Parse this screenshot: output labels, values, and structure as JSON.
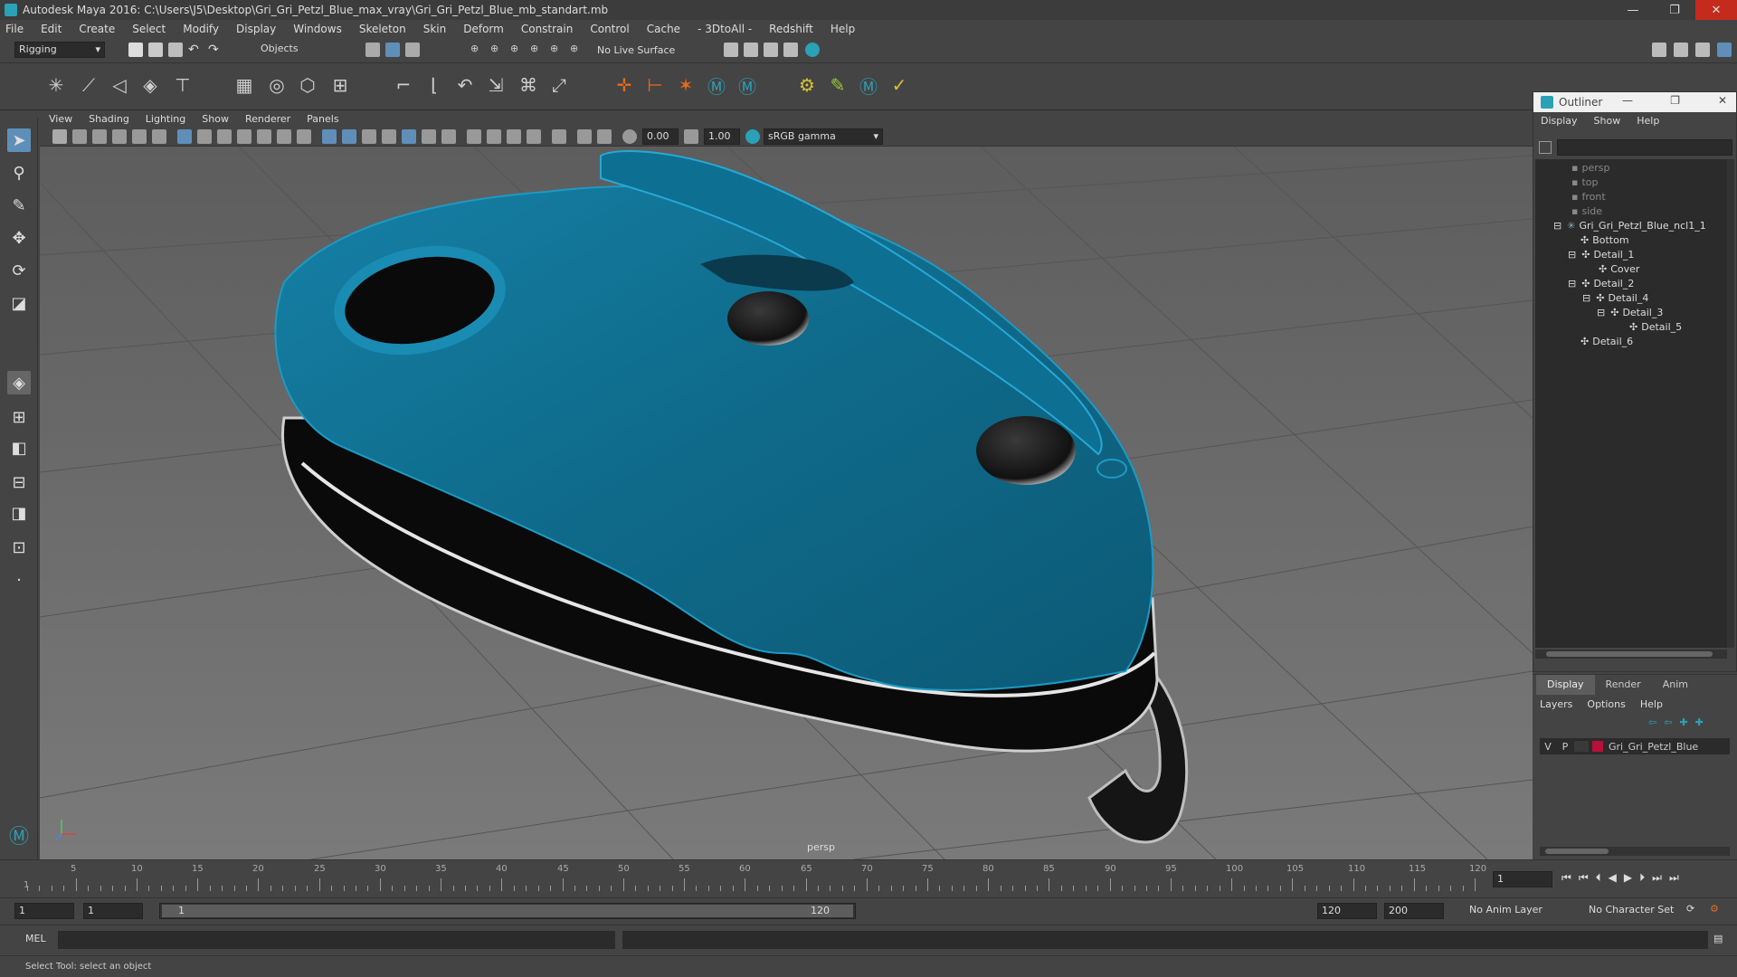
{
  "window": {
    "title": "Autodesk Maya 2016: C:\\Users\\J5\\Desktop\\Gri_Gri_Petzl_Blue_max_vray\\Gri_Gri_Petzl_Blue_mb_standart.mb",
    "min": "—",
    "max": "❐",
    "close": "✕"
  },
  "menubar": [
    "File",
    "Edit",
    "Create",
    "Select",
    "Modify",
    "Display",
    "Windows",
    "Skeleton",
    "Skin",
    "Deform",
    "Constrain",
    "Control",
    "Cache",
    "- 3DtoAll -",
    "Redshift",
    "Help"
  ],
  "statusline": {
    "menuset": "Rigging",
    "select_mode": "Objects",
    "live_surface": "No Live Surface"
  },
  "panel": {
    "menus": [
      "View",
      "Shading",
      "Lighting",
      "Show",
      "Renderer",
      "Panels"
    ],
    "exposure": "0.00",
    "gamma": "1.00",
    "color_space": "sRGB gamma",
    "camera_label": "persp"
  },
  "outliner": {
    "title": "Outliner",
    "menus": [
      "Display",
      "Show",
      "Help"
    ],
    "items": [
      {
        "label": "persp"
      },
      {
        "label": "top"
      },
      {
        "label": "front"
      },
      {
        "label": "side"
      },
      {
        "label": "Gri_Gri_Petzl_Blue_ncl1_1"
      },
      {
        "label": "Bottom"
      },
      {
        "label": "Detail_1"
      },
      {
        "label": "Cover"
      },
      {
        "label": "Detail_2"
      },
      {
        "label": "Detail_4"
      },
      {
        "label": "Detail_3"
      },
      {
        "label": "Detail_5"
      },
      {
        "label": "Detail_6"
      }
    ]
  },
  "layer_editor": {
    "tabs": [
      "Display",
      "Render",
      "Anim"
    ],
    "menus": [
      "Layers",
      "Options",
      "Help"
    ],
    "layer": {
      "v": "V",
      "p": "P",
      "name": "Gri_Gri_Petzl_Blue",
      "color": "#b8103a"
    }
  },
  "timeline": {
    "ticks": [
      "5",
      "10",
      "15",
      "20",
      "25",
      "30",
      "35",
      "40",
      "45",
      "50",
      "55",
      "60",
      "65",
      "70",
      "75",
      "80",
      "85",
      "90",
      "95",
      "100",
      "105",
      "110",
      "115",
      "120"
    ],
    "start_label": "1",
    "current_frame": "1"
  },
  "range": {
    "start": "1",
    "current": "1",
    "range_start": "1",
    "range_end": "120",
    "anim_end": "120",
    "max_end": "200",
    "anim_layer": "No Anim Layer",
    "character_set": "No Character Set"
  },
  "command": {
    "lang": "MEL"
  },
  "help_line": "Select Tool: select an object",
  "colors": {
    "model_blue": "#0f6a8a",
    "model_dark": "#0a0a0a",
    "accent": "#2aa1b6"
  }
}
